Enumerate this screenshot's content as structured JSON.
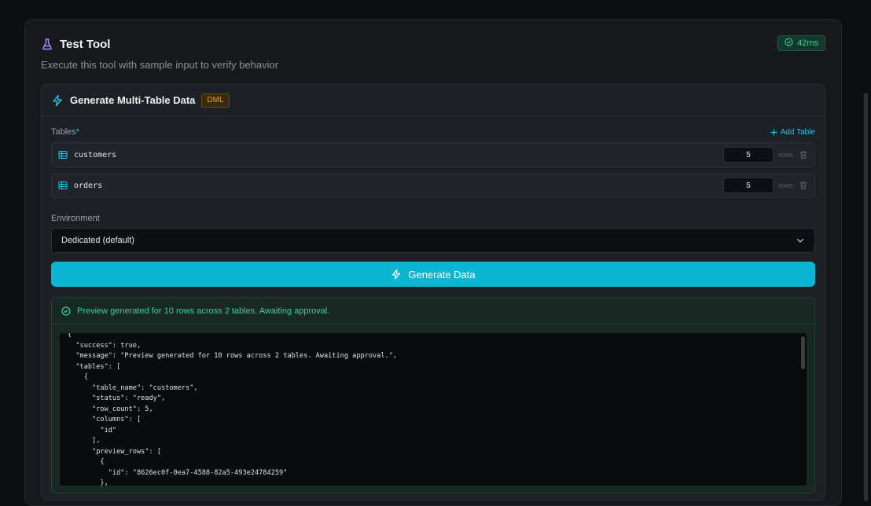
{
  "panel": {
    "title": "Test Tool",
    "subtitle": "Execute this tool with sample input to verify behavior",
    "timing": "42ms"
  },
  "tool": {
    "name": "Generate Multi-Table Data",
    "badge": "DML"
  },
  "tables": {
    "label": "Tables",
    "required_mark": "*",
    "add_label": "Add Table",
    "rows_suffix": "rows",
    "items": [
      {
        "name": "customers",
        "rows": "5"
      },
      {
        "name": "orders",
        "rows": "5"
      }
    ]
  },
  "environment": {
    "label": "Environment",
    "selected": "Dedicated (default)"
  },
  "generate_button": "Generate Data",
  "result": {
    "message": "Preview generated for 10 rows across 2 tables. Awaiting approval.",
    "json_text": "{\n  \"success\": true,\n  \"message\": \"Preview generated for 10 rows across 2 tables. Awaiting approval.\",\n  \"tables\": [\n    {\n      \"table_name\": \"customers\",\n      \"status\": \"ready\",\n      \"row_count\": 5,\n      \"columns\": [\n        \"id\"\n      ],\n      \"preview_rows\": [\n        {\n          \"id\": \"8626ec0f-0ea7-4588-82a5-493e24784259\"\n        },"
  },
  "icons": {
    "flask": "flask-icon",
    "timing": "check-circle-icon",
    "tool": "lightning-icon",
    "add": "plus-icon",
    "table": "table-grid-icon",
    "delete": "trash-icon",
    "dropdown": "chevron-down-icon",
    "success": "check-circle-icon"
  },
  "colors": {
    "accent": "#0bb6d4",
    "flask": "#a78bfa",
    "success": "#34d399",
    "warning": "#f59e0b"
  }
}
